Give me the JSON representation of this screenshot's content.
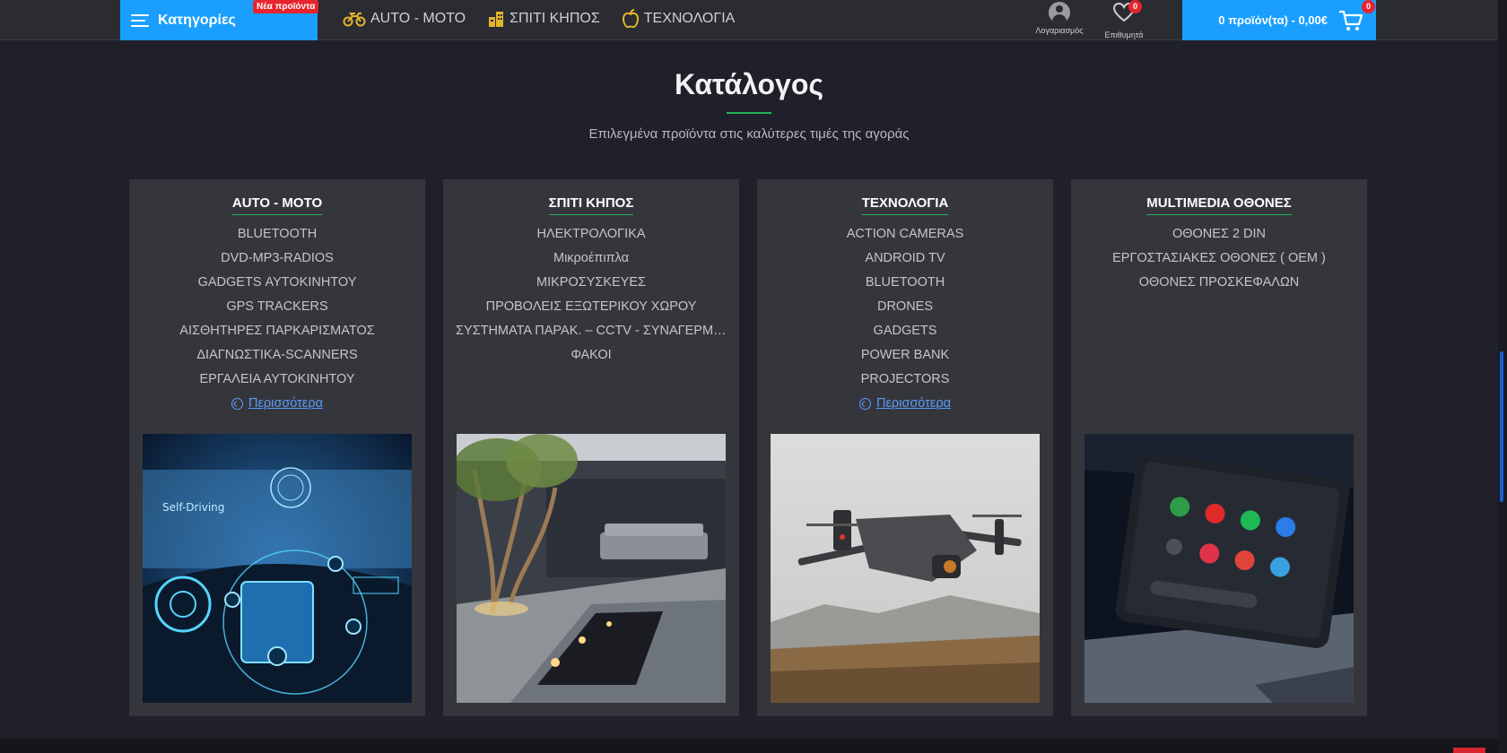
{
  "header": {
    "categories_label": "Κατηγορίες",
    "new_badge": "Νέα προϊόντα",
    "nav": [
      {
        "label": "AUTO - MOTO",
        "icon": "motorcycle-icon"
      },
      {
        "label": "ΣΠΙΤΙ ΚΗΠΟΣ",
        "icon": "building-icon"
      },
      {
        "label": "ΤΕΧΝΟΛΟΓΙΑ",
        "icon": "apple-icon"
      }
    ],
    "account_label": "Λογαριασμός",
    "wishlist_label": "Επιθυμητά",
    "wishlist_count": "0",
    "cart_label": "0 προϊόν(τα) - 0,00€",
    "cart_count": "0"
  },
  "catalog": {
    "title": "Κατάλογος",
    "subtitle": "Επιλεγμένα προϊόντα στις καλύτερες τιμές της αγοράς"
  },
  "cards": [
    {
      "title": "AUTO - MOTO",
      "items": [
        "BLUETOOTH",
        "DVD-MP3-RADIOS",
        "GADGETS ΑΥΤΟΚΙΝΗΤΟΥ",
        "GPS TRACKERS",
        "ΑΙΣΘΗΤΗΡΕΣ ΠΑΡΚΑΡΙΣΜΑΤΟΣ",
        "ΔΙΑΓΝΩΣΤΙΚΑ-SCANNERS",
        "ΕΡΓΑΛΕΙΑ ΑΥΤΟΚΙΝΗΤΟΥ"
      ],
      "more": "Περισσότερα"
    },
    {
      "title": "ΣΠΙΤΙ ΚΗΠΟΣ",
      "items": [
        "ΗΛΕΚΤΡΟΛΟΓΙΚΑ",
        "Μικροέπιπλα",
        "ΜΙΚΡΟΣΥΣΚΕΥΕΣ",
        "ΠΡΟΒΟΛΕΙΣ ΕΞΩΤΕΡΙΚΟΥ ΧΩΡΟΥ",
        "ΣΥΣΤΗΜΑΤΑ ΠΑΡΑΚ. – CCTV - ΣΥΝΑΓΕΡΜΟΙ",
        "ΦΑΚΟΙ"
      ]
    },
    {
      "title": "ΤΕΧΝΟΛΟΓΙΑ",
      "items": [
        "ACTION CAMERAS",
        "ANDROID TV",
        "BLUETOOTH",
        "DRONES",
        "GADGETS",
        "POWER BANK",
        "PROJECTORS"
      ],
      "more": "Περισσότερα"
    },
    {
      "title": "MULTIMEDIA ΟΘΟΝΕΣ",
      "items": [
        "ΟΘΟΝΕΣ 2 DIN",
        "ΕΡΓΟΣΤΑΣΙΑΚΕΣ ΟΘΟΝΕΣ ( OEM )",
        "ΟΘΟΝΕΣ ΠΡΟΣΚΕΦΑΛΩΝ"
      ]
    }
  ],
  "colors": {
    "accent": "#1a9fff",
    "badge": "#e8232e",
    "underline": "#20b35b",
    "link": "#5b9cff",
    "nav_icon": "#e3b52b"
  }
}
